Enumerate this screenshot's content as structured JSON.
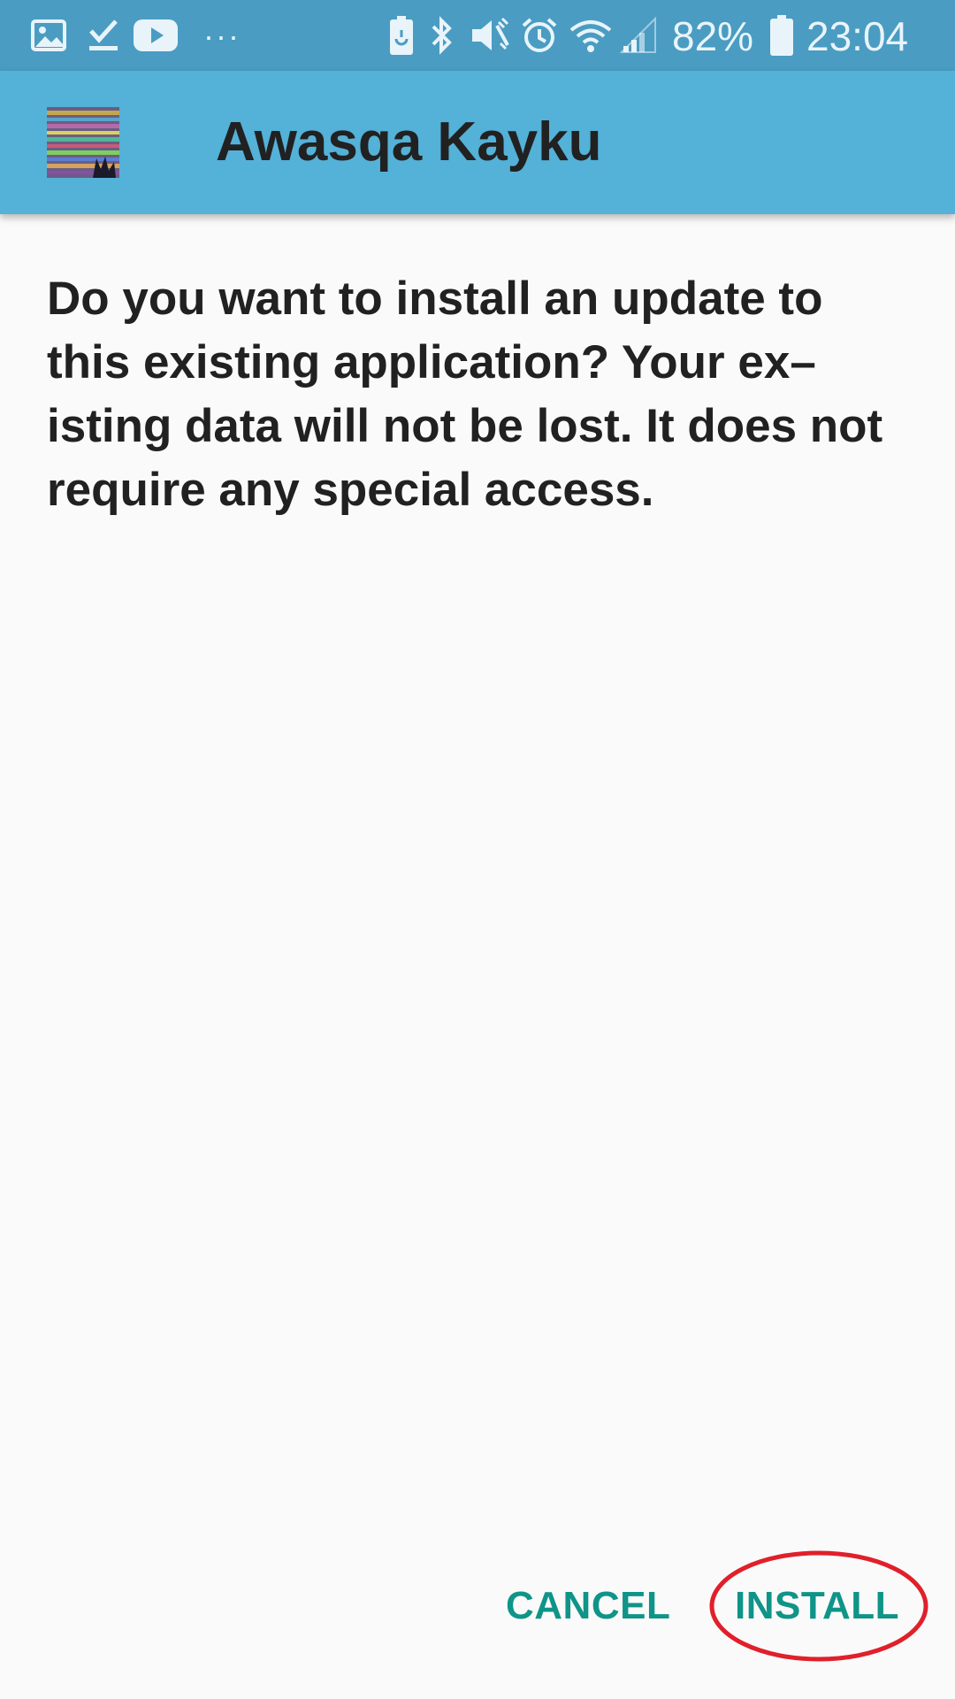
{
  "status_bar": {
    "left_icons": [
      "gallery-icon",
      "task-check-icon",
      "youtube-icon",
      "more-dots-icon"
    ],
    "more_label": "···",
    "right_icons": [
      "battery-saver-icon",
      "bluetooth-icon",
      "vibrate-mute-icon",
      "alarm-icon",
      "wifi-icon",
      "signal-icon",
      "battery-icon"
    ],
    "battery_percent": "82%",
    "time": "23:04",
    "background_color": "#4a9cc2"
  },
  "app_bar": {
    "title": "Awasqa Kayku",
    "icon": "app-icon",
    "background_color": "#54b1d8"
  },
  "dialog": {
    "message": "Do you want to install an update to this existing application? Your ex–isting data will not be lost. It does not require any special access."
  },
  "buttons": {
    "cancel_label": "CANCEL",
    "install_label": "INSTALL",
    "accent_color": "#0f9488"
  },
  "annotation": {
    "type": "ellipse-highlight",
    "target": "install-button",
    "color": "#e0202a"
  }
}
